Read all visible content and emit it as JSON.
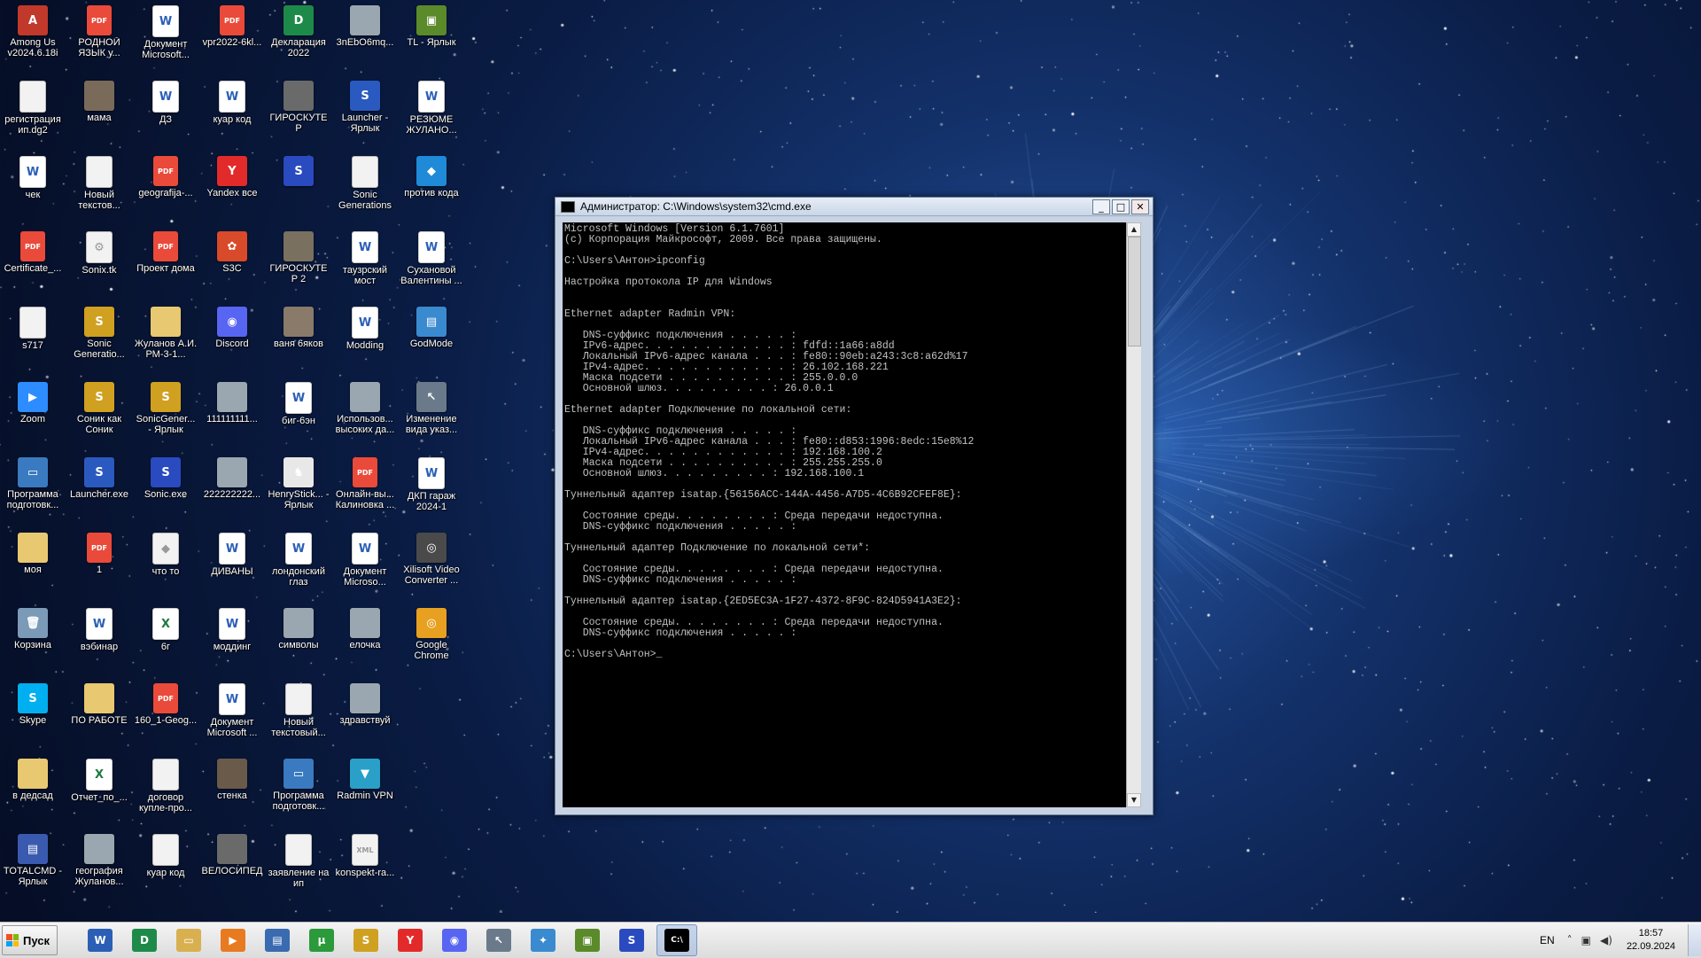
{
  "desktop": {
    "icons": [
      {
        "label": "Among Us v2024.6.18i",
        "kind": "app",
        "glyph": "A",
        "color": "#c0392b"
      },
      {
        "label": "РОДНОЙ ЯЗЫК у...",
        "kind": "pdf",
        "glyph": "PDF"
      },
      {
        "label": "Документ Microsoft...",
        "kind": "doc",
        "glyph": "W"
      },
      {
        "label": "vpr2022-6kl...",
        "kind": "pdf",
        "glyph": "PDF"
      },
      {
        "label": "Декларация 2022",
        "kind": "app",
        "glyph": "D",
        "color": "#1e8a4a"
      },
      {
        "label": "3nEbO6mq...",
        "kind": "img",
        "glyph": ""
      },
      {
        "label": "TL - Ярлык",
        "kind": "app",
        "glyph": "▣",
        "color": "#5a8a2a"
      },
      {
        "label": "регистрация ип.dg2",
        "kind": "blank",
        "glyph": ""
      },
      {
        "label": "мама",
        "kind": "img",
        "glyph": "",
        "color": "#7a6a5a"
      },
      {
        "label": "ДЗ",
        "kind": "doc",
        "glyph": "W"
      },
      {
        "label": "куар код",
        "kind": "doc",
        "glyph": "W"
      },
      {
        "label": "ГИРОСКУТЕР",
        "kind": "img",
        "glyph": "",
        "color": "#6a6a6a"
      },
      {
        "label": "Launcher - Ярлык",
        "kind": "app",
        "glyph": "S",
        "color": "#2a5ac0"
      },
      {
        "label": "РЕЗЮМЕ ЖУЛАНО...",
        "kind": "doc",
        "glyph": "W"
      },
      {
        "label": "чек",
        "kind": "doc",
        "glyph": "W"
      },
      {
        "label": "Новый текстов...",
        "kind": "blank",
        "glyph": ""
      },
      {
        "label": "geografija-...",
        "kind": "pdf",
        "glyph": "PDF"
      },
      {
        "label": "Yandex все",
        "kind": "app",
        "glyph": "Y",
        "color": "#e32a2a"
      },
      {
        "label": "",
        "kind": "app",
        "glyph": "S",
        "color": "#2a4ac0"
      },
      {
        "label": "Sonic Generations",
        "kind": "blank",
        "glyph": ""
      },
      {
        "label": "против кода",
        "kind": "app",
        "glyph": "◆",
        "color": "#1f8ad8"
      },
      {
        "label": "Certificate_...",
        "kind": "pdf",
        "glyph": "PDF"
      },
      {
        "label": "Sonix.tk",
        "kind": "blank",
        "glyph": "⚙"
      },
      {
        "label": "Проект дома",
        "kind": "pdf",
        "glyph": "PDF"
      },
      {
        "label": "S3C",
        "kind": "app",
        "glyph": "✿",
        "color": "#d84a2a"
      },
      {
        "label": "ГИРОСКУТЕР 2",
        "kind": "img",
        "glyph": "",
        "color": "#7a7060"
      },
      {
        "label": "таузрский мост",
        "kind": "doc",
        "glyph": "W"
      },
      {
        "label": "Сухановой Валентины ...",
        "kind": "doc",
        "glyph": "W"
      },
      {
        "label": "s717",
        "kind": "blank",
        "glyph": ""
      },
      {
        "label": "Sonic Generatio...",
        "kind": "app",
        "glyph": "S",
        "color": "#d0a020"
      },
      {
        "label": "Жуланов А.И. РМ-3-1...",
        "kind": "folder",
        "glyph": ""
      },
      {
        "label": "Discord",
        "kind": "app",
        "glyph": "◉",
        "color": "#5865f2"
      },
      {
        "label": "ваня 6яков",
        "kind": "img",
        "glyph": "",
        "color": "#8a7a6a"
      },
      {
        "label": "Modding",
        "kind": "doc",
        "glyph": "W"
      },
      {
        "label": "GodMode",
        "kind": "app",
        "glyph": "▤",
        "color": "#3a8ad0"
      },
      {
        "label": "Zoom",
        "kind": "app",
        "glyph": "▶",
        "color": "#2d8cff"
      },
      {
        "label": "Соник как Соник",
        "kind": "app",
        "glyph": "S",
        "color": "#d0a020"
      },
      {
        "label": "SonicGener... - Ярлык",
        "kind": "app",
        "glyph": "S",
        "color": "#d0a020"
      },
      {
        "label": "111111111...",
        "kind": "img",
        "glyph": ""
      },
      {
        "label": "биг-6эн",
        "kind": "doc",
        "glyph": "W"
      },
      {
        "label": "Использов... высоких да...",
        "kind": "img",
        "glyph": ""
      },
      {
        "label": "Изменение вида указ...",
        "kind": "app",
        "glyph": "↖",
        "color": "#6a7a8a"
      },
      {
        "label": "Программа подготовк...",
        "kind": "app",
        "glyph": "▭",
        "color": "#3a7ac0"
      },
      {
        "label": "Launcher.exe",
        "kind": "app",
        "glyph": "S",
        "color": "#2a5ac0"
      },
      {
        "label": "Sonic.exe",
        "kind": "app",
        "glyph": "S",
        "color": "#2a4ac0"
      },
      {
        "label": "222222222...",
        "kind": "img",
        "glyph": ""
      },
      {
        "label": "HenryStick... - Ярлык",
        "kind": "app",
        "glyph": "♞",
        "color": "#e8e8e8"
      },
      {
        "label": "Онлайн-вы... Калиновка ...",
        "kind": "pdf",
        "glyph": "PDF"
      },
      {
        "label": "ДКП гараж 2024-1",
        "kind": "doc",
        "glyph": "W"
      },
      {
        "label": "моя",
        "kind": "folder",
        "glyph": ""
      },
      {
        "label": "1",
        "kind": "pdf",
        "glyph": "PDF"
      },
      {
        "label": "что то",
        "kind": "blank",
        "glyph": "◆"
      },
      {
        "label": "ДИВАНЫ",
        "kind": "doc",
        "glyph": "W"
      },
      {
        "label": "лондонский глаз",
        "kind": "doc",
        "glyph": "W"
      },
      {
        "label": "Документ Microso...",
        "kind": "doc",
        "glyph": "W"
      },
      {
        "label": "Xilisoft Video Converter ...",
        "kind": "app",
        "glyph": "◎",
        "color": "#4a4a4a"
      },
      {
        "label": "Корзина",
        "kind": "app",
        "glyph": "🗑",
        "color": "#7a9ab8"
      },
      {
        "label": "вэбинар",
        "kind": "doc",
        "glyph": "W"
      },
      {
        "label": "6г",
        "kind": "xls",
        "glyph": "X"
      },
      {
        "label": "моддинг",
        "kind": "doc",
        "glyph": "W"
      },
      {
        "label": "символы",
        "kind": "img",
        "glyph": ""
      },
      {
        "label": "елочка",
        "kind": "img",
        "glyph": ""
      },
      {
        "label": "Google Chrome",
        "kind": "app",
        "glyph": "◎",
        "color": "#e8a020"
      },
      {
        "label": "Skype",
        "kind": "app",
        "glyph": "S",
        "color": "#00aff0"
      },
      {
        "label": "ПО РАБОТЕ",
        "kind": "folder",
        "glyph": ""
      },
      {
        "label": "160_1-Geog...",
        "kind": "pdf",
        "glyph": "PDF"
      },
      {
        "label": "Документ Microsoft ...",
        "kind": "doc",
        "glyph": "W"
      },
      {
        "label": "Новый текстовый...",
        "kind": "blank",
        "glyph": ""
      },
      {
        "label": "здравствуй",
        "kind": "img",
        "glyph": ""
      },
      {
        "label": "",
        "kind": "none",
        "glyph": ""
      },
      {
        "label": "в дедсад",
        "kind": "folder",
        "glyph": ""
      },
      {
        "label": "Отчет_по_...",
        "kind": "xls",
        "glyph": "X"
      },
      {
        "label": "договор купле-про...",
        "kind": "blank",
        "glyph": ""
      },
      {
        "label": "стенка",
        "kind": "img",
        "glyph": "",
        "color": "#6a5a4a"
      },
      {
        "label": "Программа подготовк...",
        "kind": "app",
        "glyph": "▭",
        "color": "#3a7ac0"
      },
      {
        "label": "Radmin VPN",
        "kind": "app",
        "glyph": "▼",
        "color": "#2aa0c8"
      },
      {
        "label": "",
        "kind": "none",
        "glyph": ""
      },
      {
        "label": "TOTALCMD - Ярлык",
        "kind": "app",
        "glyph": "▤",
        "color": "#3a5ab0"
      },
      {
        "label": "география Жуланов...",
        "kind": "img",
        "glyph": ""
      },
      {
        "label": "куар код",
        "kind": "blank",
        "glyph": ""
      },
      {
        "label": "ВЕЛОСИПЕД",
        "kind": "img",
        "glyph": "",
        "color": "#6a6a6a"
      },
      {
        "label": "заявление на ип",
        "kind": "blank",
        "glyph": ""
      },
      {
        "label": "konspekt-ra...",
        "kind": "blank",
        "glyph": "XML"
      },
      {
        "label": "",
        "kind": "none",
        "glyph": ""
      }
    ]
  },
  "cmd": {
    "title": "Администратор: C:\\Windows\\system32\\cmd.exe",
    "controls": {
      "minimize": "_",
      "maximize": "□",
      "close": "✕"
    },
    "lines": [
      "Microsoft Windows [Version 6.1.7601]",
      "(c) Корпорация Майкрософт, 2009. Все права защищены.",
      "",
      "C:\\Users\\Антон>ipconfig",
      "",
      "Настройка протокола IP для Windows",
      "",
      "",
      "Ethernet adapter Radmin VPN:",
      "",
      "   DNS-суффикс подключения . . . . . :",
      "   IPv6-адрес. . . . . . . . . . . . : fdfd::1a66:a8dd",
      "   Локальный IPv6-адрес канала . . . : fe80::90eb:a243:3c8:a62d%17",
      "   IPv4-адрес. . . . . . . . . . . . : 26.102.168.221",
      "   Маска подсети . . . . . . . . . . : 255.0.0.0",
      "   Основной шлюз. . . . . . . . . : 26.0.0.1",
      "",
      "Ethernet adapter Подключение по локальной сети:",
      "",
      "   DNS-суффикс подключения . . . . . :",
      "   Локальный IPv6-адрес канала . . . : fe80::d853:1996:8edc:15e8%12",
      "   IPv4-адрес. . . . . . . . . . . . : 192.168.100.2",
      "   Маска подсети . . . . . . . . . . : 255.255.255.0",
      "   Основной шлюз. . . . . . . . . : 192.168.100.1",
      "",
      "Туннельный адаптер isatap.{56156ACC-144A-4456-A7D5-4C6B92CFEF8E}:",
      "",
      "   Состояние среды. . . . . . . . : Среда передачи недоступна.",
      "   DNS-суффикс подключения . . . . . :",
      "",
      "Туннельный адаптер Подключение по локальной сети*:",
      "",
      "   Состояние среды. . . . . . . . : Среда передачи недоступна.",
      "   DNS-суффикс подключения . . . . . :",
      "",
      "Туннельный адаптер isatap.{2ED5EC3A-1F27-4372-8F9C-824D5941A3E2}:",
      "",
      "   Состояние среды. . . . . . . . : Среда передачи недоступна.",
      "   DNS-суффикс подключения . . . . . :",
      "",
      "C:\\Users\\Антон>_"
    ]
  },
  "taskbar": {
    "start_label": "Пуск",
    "apps": [
      {
        "name": "word-icon",
        "glyph": "W",
        "color": "#2b5fb5",
        "active": false
      },
      {
        "name": "declaration-icon",
        "glyph": "D",
        "color": "#1e8a4a",
        "active": false
      },
      {
        "name": "explorer-icon",
        "glyph": "▭",
        "color": "#d8b050",
        "active": false
      },
      {
        "name": "media-player-icon",
        "glyph": "▶",
        "color": "#e87a20",
        "active": false
      },
      {
        "name": "network-icon",
        "glyph": "▤",
        "color": "#3a6ab0",
        "active": false
      },
      {
        "name": "utorrent-icon",
        "glyph": "µ",
        "color": "#2a9a3a",
        "active": false
      },
      {
        "name": "sonic-icon",
        "glyph": "S",
        "color": "#d0a020",
        "active": false
      },
      {
        "name": "yandex-icon",
        "glyph": "Y",
        "color": "#e32a2a",
        "active": false
      },
      {
        "name": "discord-icon",
        "glyph": "◉",
        "color": "#5865f2",
        "active": false
      },
      {
        "name": "cursor-tool-icon",
        "glyph": "↖",
        "color": "#6a7a8a",
        "active": false
      },
      {
        "name": "settings-app-icon",
        "glyph": "✦",
        "color": "#3a8ad0",
        "active": false
      },
      {
        "name": "minecraft-icon",
        "glyph": "▣",
        "color": "#5a8a2a",
        "active": false
      },
      {
        "name": "sonic-launcher-icon",
        "glyph": "S",
        "color": "#2a4ac0",
        "active": false
      },
      {
        "name": "cmd-icon",
        "glyph": "C:\\",
        "color": "#000000",
        "active": true
      }
    ],
    "tray": {
      "language": "EN",
      "chevron": "˄",
      "time": "18:57",
      "date": "22.09.2024"
    }
  }
}
